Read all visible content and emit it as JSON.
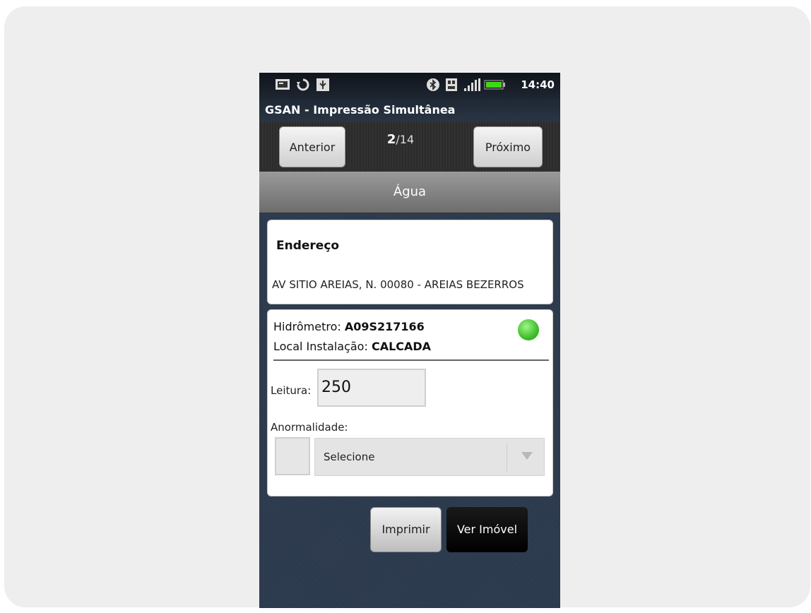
{
  "status_bar": {
    "time": "14:40",
    "left_icons": [
      "screenshot-icon",
      "sync-icon",
      "usb-icon"
    ],
    "right_icons": [
      "bluetooth-icon",
      "sd-card-icon",
      "signal-icon",
      "battery-icon"
    ]
  },
  "app": {
    "title": "GSAN - Impressão Simultânea"
  },
  "nav": {
    "prev_label": "Anterior",
    "next_label": "Próximo",
    "current": "2",
    "total": "/14"
  },
  "tab": {
    "label": "Água"
  },
  "address": {
    "heading": "Endereço",
    "value": "AV SITIO AREIAS, N. 00080 - AREIAS BEZERROS"
  },
  "meter": {
    "hidrometro_label": "Hidrômetro: ",
    "hidrometro_value": "A09S217166",
    "local_label": "Local Instalação: ",
    "local_value": "CALCADA",
    "status_color": "#3fbf2a"
  },
  "reading": {
    "label": "Leitura:",
    "value": "250"
  },
  "anomaly": {
    "label": "Anormalidade:",
    "selected": "Selecione"
  },
  "actions": {
    "print_label": "Imprimir",
    "view_label": "Ver Imóvel"
  }
}
